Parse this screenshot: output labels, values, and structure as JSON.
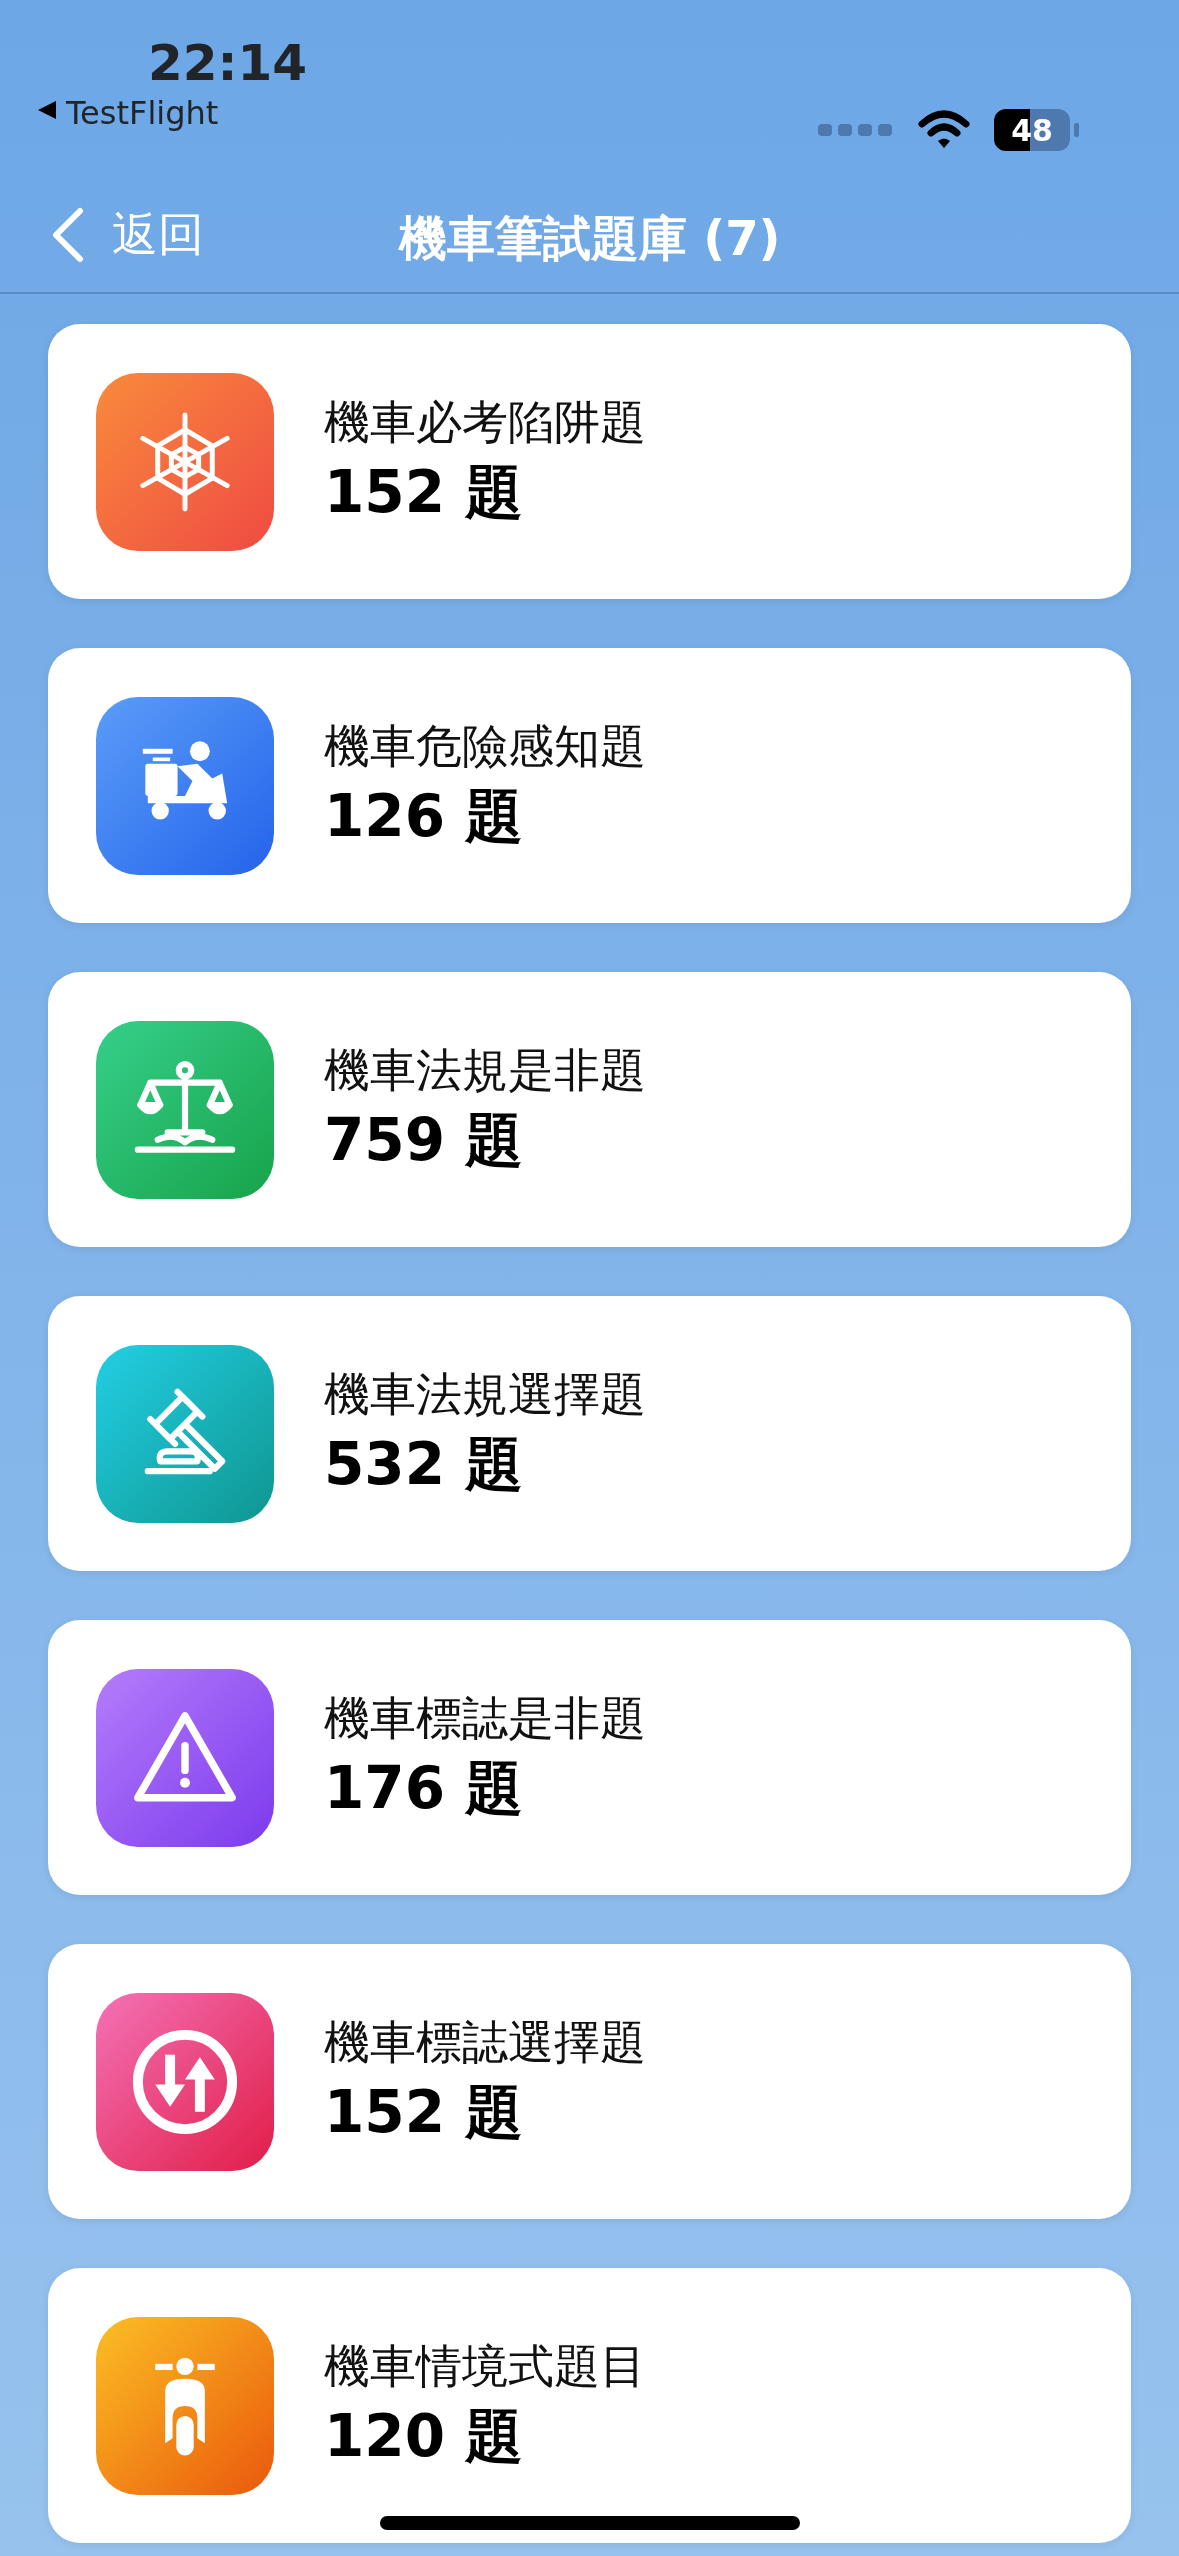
{
  "status_bar": {
    "time": "22:14",
    "back_app": "TestFlight",
    "battery": "48"
  },
  "nav_bar": {
    "back_label": "返回",
    "title": "機車筆試題庫 (7)"
  },
  "items": [
    {
      "kind": "web",
      "title": "機車必考陷阱題",
      "count": "152 題"
    },
    {
      "kind": "delivery",
      "title": "機車危險感知題",
      "count": "126 題"
    },
    {
      "kind": "scales",
      "title": "機車法規是非題",
      "count": "759 題"
    },
    {
      "kind": "gavel",
      "title": "機車法規選擇題",
      "count": "532 題"
    },
    {
      "kind": "warning",
      "title": "機車標誌是非題",
      "count": "176 題"
    },
    {
      "kind": "twoway",
      "title": "機車標誌選擇題",
      "count": "152 題"
    },
    {
      "kind": "scooter",
      "title": "機車情境式題目",
      "count": "120 題"
    }
  ]
}
